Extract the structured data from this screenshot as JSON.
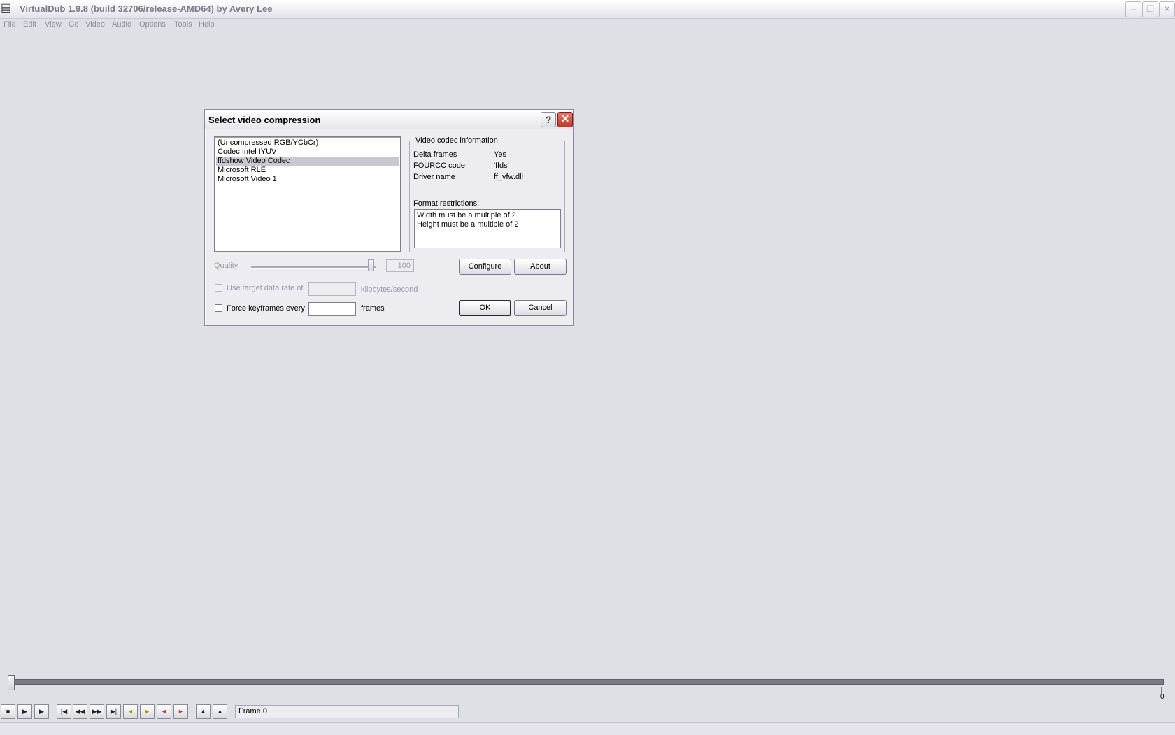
{
  "window": {
    "title": "VirtualDub 1.9.8 (build 32706/release-AMD64) by Avery Lee",
    "icon": "film-icon",
    "controls": [
      "minimize",
      "restore",
      "close"
    ]
  },
  "menu": [
    "File",
    "Edit",
    "View",
    "Go",
    "Video",
    "Audio",
    "Options",
    "Tools",
    "Help"
  ],
  "dialog": {
    "title": "Select video compression",
    "codecs": [
      "(Uncompressed RGB/YCbCr)",
      "Codec Intel IYUV",
      "ffdshow Video Codec",
      "Microsoft RLE",
      "Microsoft Video 1"
    ],
    "selected_codec": "ffdshow Video Codec",
    "info": {
      "legend": "Video codec information",
      "rows": [
        {
          "label": "Delta frames",
          "value": "Yes"
        },
        {
          "label": "FOURCC code",
          "value": "'ffds'"
        },
        {
          "label": "Driver name",
          "value": "ff_vfw.dll"
        }
      ],
      "format_label": "Format restrictions:",
      "format_lines": [
        "Width must be a multiple of 2",
        "Height must be a multiple of 2"
      ]
    },
    "quality": {
      "label": "Quality",
      "value": "100",
      "level_percent": 100
    },
    "configure_label": "Configure",
    "about_label": "About",
    "target_rate": {
      "label": "Use target data rate of",
      "value": "",
      "unit": "kilobytes/second",
      "checked": false,
      "enabled": false
    },
    "keyframes": {
      "label": "Force keyframes every",
      "value": "",
      "unit": "frames",
      "checked": false
    },
    "ok_label": "OK",
    "cancel_label": "Cancel"
  },
  "timeline": {
    "end_label": "0",
    "position": 0
  },
  "frame_display": "Frame 0",
  "colors": {
    "background": "#dfdfe6",
    "dialog": "#ececf1",
    "timeline": "#7c7c82",
    "close_red": "#c0392b"
  }
}
